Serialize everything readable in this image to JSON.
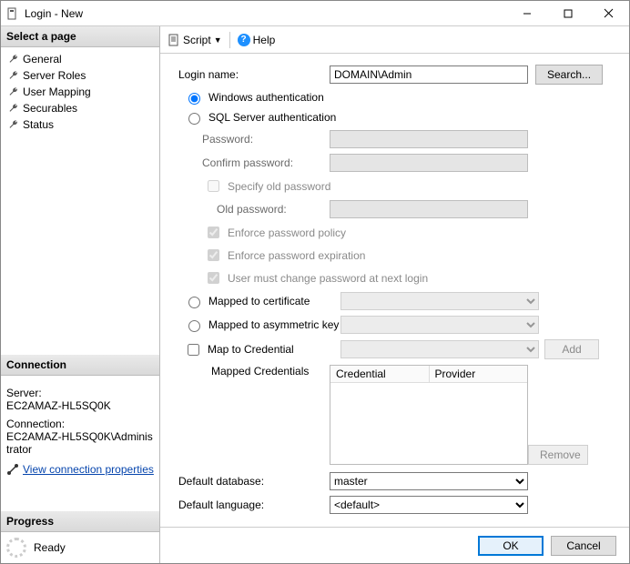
{
  "title": "Login - New",
  "leftPane": {
    "selectPageHeader": "Select a page",
    "pages": [
      "General",
      "Server Roles",
      "User Mapping",
      "Securables",
      "Status"
    ],
    "connectionHeader": "Connection",
    "serverLabel": "Server:",
    "serverValue": "EC2AMAZ-HL5SQ0K",
    "connectionLabel": "Connection:",
    "connectionValue": "EC2AMAZ-HL5SQ0K\\Administrator",
    "viewConnLink": "View connection properties",
    "progressHeader": "Progress",
    "progressStatus": "Ready"
  },
  "toolbar": {
    "script": "Script",
    "help": "Help"
  },
  "form": {
    "loginNameLabel": "Login name:",
    "loginNameValue": "DOMAIN\\Admin",
    "searchBtn": "Search...",
    "winAuth": "Windows authentication",
    "sqlAuth": "SQL Server authentication",
    "passwordLabel": "Password:",
    "confirmPasswordLabel": "Confirm password:",
    "specifyOld": "Specify old password",
    "oldPasswordLabel": "Old password:",
    "enforcePolicy": "Enforce password policy",
    "enforceExpiration": "Enforce password expiration",
    "mustChange": "User must change password at next login",
    "mappedCert": "Mapped to certificate",
    "mappedAsym": "Mapped to asymmetric key",
    "mapCred": "Map to Credential",
    "addBtn": "Add",
    "mappedCredsLabel": "Mapped Credentials",
    "credCol": "Credential",
    "providerCol": "Provider",
    "removeBtn": "Remove",
    "defaultDbLabel": "Default database:",
    "defaultDbValue": "master",
    "defaultLangLabel": "Default language:",
    "defaultLangValue": "<default>"
  },
  "footer": {
    "ok": "OK",
    "cancel": "Cancel"
  }
}
